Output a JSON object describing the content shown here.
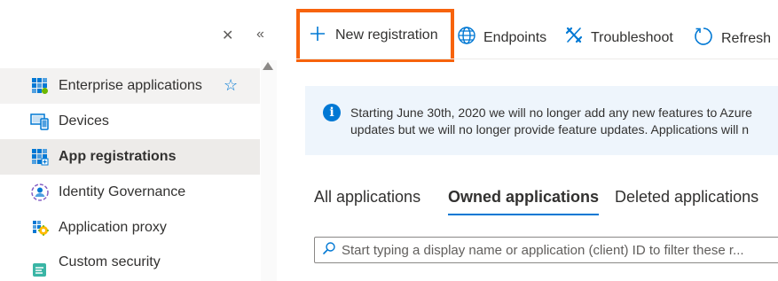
{
  "sidebar": {
    "controls": {
      "close_icon": "close-icon",
      "collapse_icon": "double-chevron-left-icon"
    },
    "items": [
      {
        "label": "Enterprise applications",
        "icon": "enterprise-apps-icon",
        "state": "hover",
        "favorite": true
      },
      {
        "label": "Devices",
        "icon": "devices-icon",
        "state": "normal"
      },
      {
        "label": "App registrations",
        "icon": "app-registrations-icon",
        "state": "selected"
      },
      {
        "label": "Identity Governance",
        "icon": "identity-governance-icon",
        "state": "normal"
      },
      {
        "label": "Application proxy",
        "icon": "application-proxy-icon",
        "state": "normal"
      },
      {
        "label": "Custom security",
        "icon": "custom-security-icon",
        "state": "normal"
      }
    ],
    "favorite_glyph": "☆"
  },
  "toolbar": {
    "new_registration": "New registration",
    "endpoints": "Endpoints",
    "troubleshoot": "Troubleshoot",
    "refresh": "Refresh",
    "highlight_color": "#f7630c"
  },
  "banner": {
    "line1": "Starting June 30th, 2020 we will no longer add any new features to Azure",
    "line2": "updates but we will no longer provide feature updates. Applications will n",
    "icon": "info-icon"
  },
  "tabs": {
    "all": "All applications",
    "owned": "Owned applications",
    "deleted": "Deleted applications",
    "active": "owned"
  },
  "search": {
    "placeholder": "Start typing a display name or application (client) ID to filter these r..."
  },
  "colors": {
    "accent": "#0078d4",
    "selected_bg": "#edebe9",
    "banner_bg": "#eef5fc"
  }
}
